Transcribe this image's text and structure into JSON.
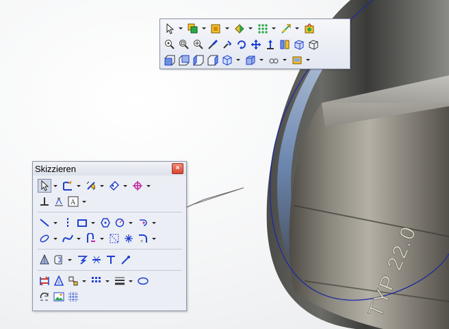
{
  "panel": {
    "title": "Skizzieren",
    "close_glyph": "×"
  },
  "part": {
    "engraving": "TYP 22.0"
  },
  "ctx_toolbar": {
    "rows": [
      [
        "select-icon",
        "dropdown",
        "assembly-icon",
        "dropdown",
        "part-icon",
        "dropdown",
        "appearance-icon",
        "dropdown",
        "pattern-icon",
        "dropdown",
        "smart-dimension-icon",
        "dropdown",
        "scene-icon"
      ],
      [
        "zoom-to-fit-icon",
        "zoom-to-area-icon",
        "zoom-in-out-icon",
        "zoom-to-selection-icon",
        "rotate-view-icon",
        "roll-view-icon",
        "pan-icon",
        "normal-to-icon",
        "section-view-icon",
        "view-orientation-icon",
        "standard-views-icon"
      ],
      [
        "front-view-icon",
        "back-view-icon",
        "left-view-icon",
        "right-view-icon",
        "isometric-icon",
        "dropdown",
        "display-style-icon",
        "dropdown",
        "hide-show-icon",
        "dropdown",
        "render-tools-icon",
        "dropdown"
      ]
    ]
  },
  "colors": {
    "accent_blue": "#1d3fd0",
    "accent_magenta": "#c020a0",
    "accent_orange": "#e08a00"
  }
}
